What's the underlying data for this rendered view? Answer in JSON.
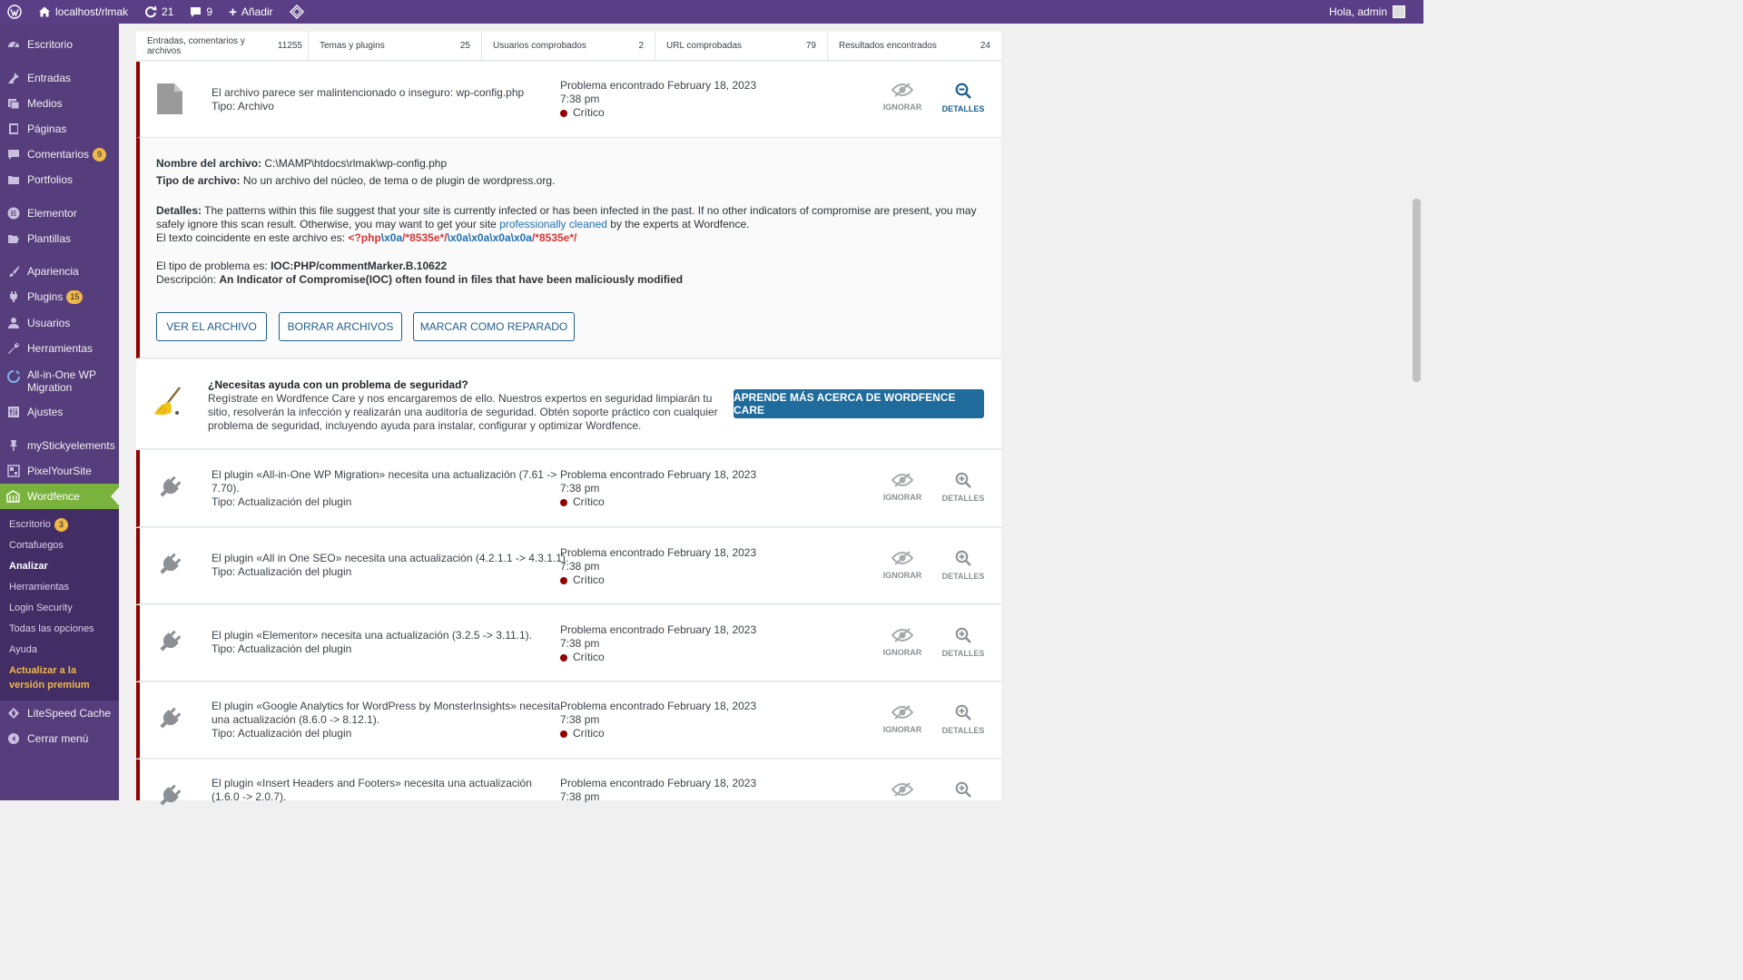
{
  "adminbar": {
    "site": "localhost/rlmak",
    "updates": "21",
    "comments": "9",
    "add": "Añadir",
    "greeting": "Hola, admin"
  },
  "sidebar": {
    "items": [
      {
        "label": "Escritorio",
        "icon": "dashboard-icon"
      },
      {
        "label": "Entradas",
        "icon": "pin-icon"
      },
      {
        "label": "Medios",
        "icon": "media-icon"
      },
      {
        "label": "Páginas",
        "icon": "page-icon"
      },
      {
        "label": "Comentarios",
        "icon": "comment-icon",
        "badge": "9"
      },
      {
        "label": "Portfolios",
        "icon": "folder-icon"
      },
      {
        "label": "Elementor",
        "icon": "elementor-icon"
      },
      {
        "label": "Plantillas",
        "icon": "folder-open-icon"
      },
      {
        "label": "Apariencia",
        "icon": "brush-icon"
      },
      {
        "label": "Plugins",
        "icon": "plugin-icon",
        "badge": "15"
      },
      {
        "label": "Usuarios",
        "icon": "user-icon"
      },
      {
        "label": "Herramientas",
        "icon": "wrench-icon"
      },
      {
        "label": "All-in-One WP Migration",
        "icon": "migration-icon"
      },
      {
        "label": "Ajustes",
        "icon": "settings-icon"
      },
      {
        "label": "myStickyelements",
        "icon": "pin-icon"
      },
      {
        "label": "PixelYourSite",
        "icon": "grid-icon"
      },
      {
        "label": "Wordfence",
        "icon": "wordfence-icon"
      },
      {
        "label": "LiteSpeed Cache",
        "icon": "diamond-icon"
      },
      {
        "label": "Cerrar menú",
        "icon": "collapse-icon"
      }
    ],
    "submenu": [
      {
        "label": "Escritorio",
        "badge": "3"
      },
      {
        "label": "Cortafuegos"
      },
      {
        "label": "Analizar"
      },
      {
        "label": "Herramientas"
      },
      {
        "label": "Login Security"
      },
      {
        "label": "Todas las opciones"
      },
      {
        "label": "Ayuda"
      },
      {
        "label": "Actualizar a la versión premium"
      }
    ]
  },
  "summary": [
    {
      "label": "Entradas, comentarios y archivos",
      "value": "11255"
    },
    {
      "label": "Temas y plugins",
      "value": "25"
    },
    {
      "label": "Usuarios comprobados",
      "value": "2"
    },
    {
      "label": "URL comprobadas",
      "value": "79"
    },
    {
      "label": "Resultados encontrados",
      "value": "24"
    }
  ],
  "file_issue": {
    "title": "El archivo parece ser malintencionado o inseguro: wp-config.php",
    "type": "Tipo: Archivo",
    "found": "Problema encontrado February 18, 2023",
    "time": "7:38 pm",
    "severity": "Crítico",
    "ignore": "IGNORAR",
    "details": "DETALLES"
  },
  "details": {
    "filename_label": "Nombre del archivo:",
    "filename": "C:\\MAMP\\htdocs\\rlmak\\wp-config.php",
    "filetype_label": "Tipo de archivo:",
    "filetype": "No un archivo del núcleo, de tema o de plugin de wordpress.org.",
    "details_label": "Detalles:",
    "details_text": "The patterns within this file suggest that your site is currently infected or has been infected in the past. If no other indicators of compromise are present, you may safely ignore this scan result. Otherwise, you may want to get your site",
    "details_link": "professionally cleaned",
    "details_tail": "by the experts at Wordfence.",
    "match_label": "El texto coincidente en este archivo es:",
    "match_1": "<?php",
    "match_2": "\\x0a",
    "match_3": "/*8535e*/",
    "match_4": "\\x0a\\x0a\\x0a\\x0a",
    "match_5": "/*8535e*/",
    "issue_type_label": "El tipo de problema es:",
    "issue_type": "IOC:PHP/commentMarker.B.10622",
    "description_label": "Descripción:",
    "description": "An Indicator of Compromise(IOC) often found in files that have been maliciously modified",
    "btn_view": "VER EL ARCHIVO",
    "btn_delete": "BORRAR ARCHIVOS",
    "btn_repaired": "MARCAR COMO REPARADO"
  },
  "care": {
    "title": "¿Necesitas ayuda con un problema de seguridad?",
    "text": "Regístrate en Wordfence Care y nos encargaremos de ello. Nuestros expertos en seguridad limpiarán tu sitio, resolverán la infección y realizarán una auditoría de seguridad. Obtén soporte práctico con cualquier problema de seguridad, incluyendo ayuda para instalar, configurar y optimizar Wordfence.",
    "button": "APRENDE MÁS ACERCA DE WORDFENCE CARE"
  },
  "plugin_issues": [
    {
      "line1": "El plugin «All-in-One WP Migration» necesita una actualización (7.61 ->",
      "line2": "7.70).",
      "type": "Tipo: Actualización del plugin",
      "found": "Problema encontrado February 18, 2023",
      "time": "7:38 pm",
      "severity": "Crítico"
    },
    {
      "line1": "El plugin «All in One SEO» necesita una actualización (4.2.1.1 -> 4.3.1.1).",
      "line2": "",
      "type": "Tipo: Actualización del plugin",
      "found": "Problema encontrado February 18, 2023",
      "time": "7:38 pm",
      "severity": "Crítico"
    },
    {
      "line1": "El plugin «Elementor» necesita una actualización (3.2.5 -> 3.11.1).",
      "line2": "",
      "type": "Tipo: Actualización del plugin",
      "found": "Problema encontrado February 18, 2023",
      "time": "7:38 pm",
      "severity": "Crítico"
    },
    {
      "line1": "El plugin «Google Analytics for WordPress by MonsterInsights» necesita",
      "line2": "una actualización (8.6.0 -> 8.12.1).",
      "type": "Tipo: Actualización del plugin",
      "found": "Problema encontrado February 18, 2023",
      "time": "7:38 pm",
      "severity": "Crítico"
    },
    {
      "line1": "El plugin «Insert Headers and Footers» necesita una actualización",
      "line2": "(1.6.0 -> 2.0.7).",
      "type": "",
      "found": "Problema encontrado February 18, 2023",
      "time": "7:38 pm",
      "severity": ""
    }
  ],
  "actions": {
    "ignore": "IGNORAR",
    "details": "DETALLES"
  },
  "colors": {
    "admin_purple": "#5b3f86",
    "sidebar": "#563d7c",
    "wordfence_green": "#7ab23e",
    "critical": "#930000",
    "wf_blue": "#1e6b9c"
  }
}
